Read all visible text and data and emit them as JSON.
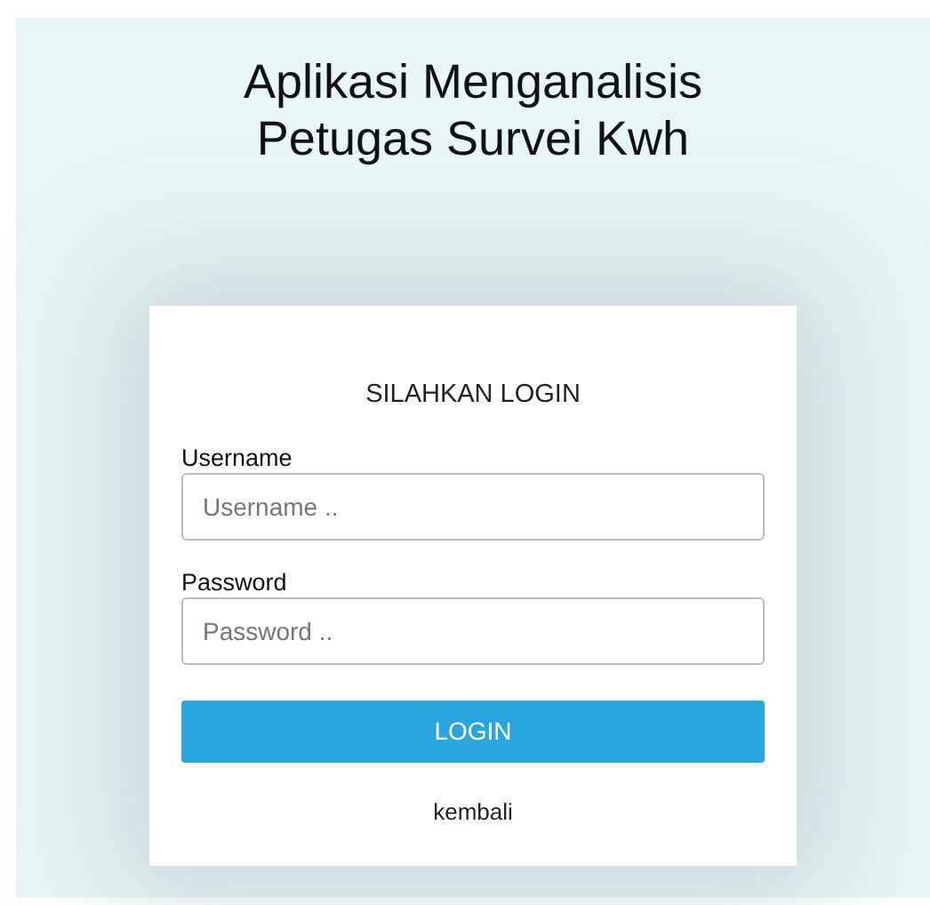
{
  "title_lines": [
    "Aplikasi Menganalisis",
    "Petugas Survei Kwh"
  ],
  "login_card": {
    "heading": "SILAHKAN LOGIN",
    "fields": [
      {
        "label": "Username",
        "placeholder": "Username .."
      },
      {
        "label": "Password",
        "placeholder": "Password .."
      }
    ],
    "button": "LOGIN",
    "back_link": "kembali"
  }
}
